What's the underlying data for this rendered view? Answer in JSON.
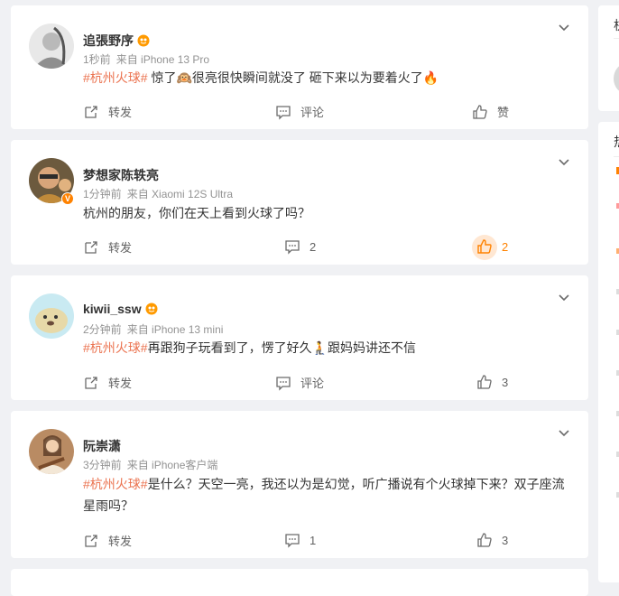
{
  "colors": {
    "accent": "#ff8200",
    "topic": "#eb7350",
    "meta": "#939393",
    "background": "#f0f1f4"
  },
  "posts": [
    {
      "user": "追張野序",
      "time": "1秒前",
      "source": "来自 iPhone 13 Pro",
      "topic": "#杭州火球#",
      "text": " 惊了🙉很亮很快瞬间就没了 砸下来以为要着火了🔥",
      "text_line2": "",
      "repost_label": "转发",
      "comment_label": "评论",
      "like_label": "赞",
      "liked": false
    },
    {
      "user": "梦想家陈轶亮",
      "time": "1分钟前",
      "source": "来自 Xiaomi 12S Ultra",
      "topic": "",
      "text": "杭州的朋友，你们在天上看到火球了吗？",
      "text_line2": "",
      "repost_label": "转发",
      "comment_label": "2",
      "like_label": "2",
      "liked": true
    },
    {
      "user": "kiwii_ssw",
      "time": "2分钟前",
      "source": "来自 iPhone 13 mini",
      "topic": "#杭州火球#",
      "text": "再跟狗子玩看到了，愣了好久🧎跟妈妈讲还不信",
      "text_line2": "",
      "repost_label": "转发",
      "comment_label": "评论",
      "like_label": "3",
      "liked": false
    },
    {
      "user": "阮崇潇",
      "time": "3分钟前",
      "source": "来自 iPhone客户端",
      "topic": "#杭州火球#",
      "text": "是什么？天空一亮，我还以为是幻觉，听广播说有个火球掉下来？双子座流",
      "text_line2": "星雨吗？",
      "repost_label": "转发",
      "comment_label": "1",
      "like_label": "3",
      "liked": false
    }
  ],
  "sidebar": {
    "top_text": "杭",
    "hot_text": "热"
  }
}
